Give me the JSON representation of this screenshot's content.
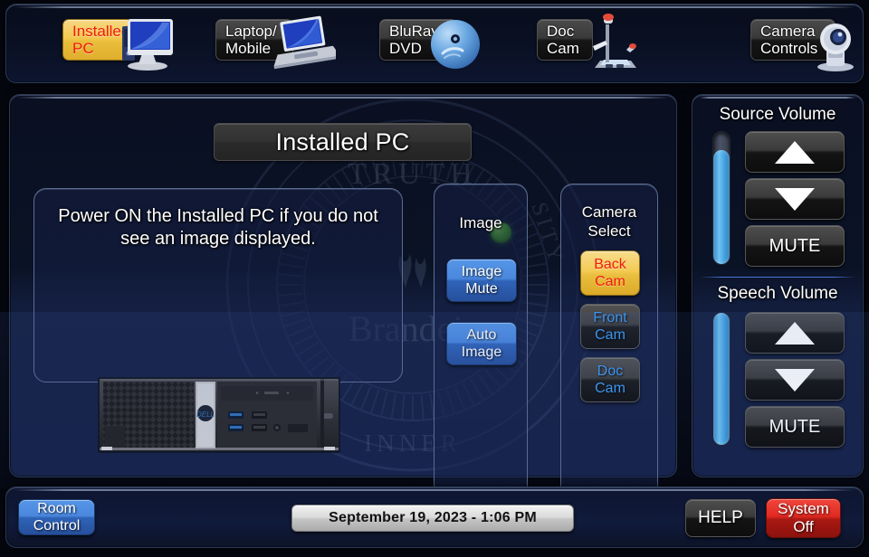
{
  "colors": {
    "active_source_bg": "#f2c94f",
    "active_source_text": "#f21a0c",
    "blue_button": "#4a87dd",
    "status_lamp": "#49b025",
    "system_off": "#e02a22",
    "slider_fill": "#49a6e4"
  },
  "topbar": {
    "sources": [
      {
        "label": "Installed\nPC",
        "icon": "desktop-pc-icon",
        "active": true
      },
      {
        "label": "Laptop/\nMobile",
        "icon": "laptop-icon",
        "active": false
      },
      {
        "label": "BluRay/\nDVD",
        "icon": "optical-disc-icon",
        "active": false
      },
      {
        "label": "Doc\nCam",
        "icon": "document-camera-icon",
        "active": false
      },
      {
        "label": "Camera\nControls",
        "icon": "ptz-camera-icon",
        "active": false
      }
    ]
  },
  "main": {
    "title": "Installed PC",
    "status_lamp_on": true,
    "info_text": "Power ON the Installed PC if you do not see an image displayed.",
    "device_image": "dell-desktop-pc",
    "watermark": "brandeis-university-seal",
    "image_panel": {
      "title": "Image",
      "buttons": [
        {
          "label": "Image\nMute"
        },
        {
          "label": "Auto\nImage"
        }
      ]
    },
    "camera_panel": {
      "title": "Camera\nSelect",
      "buttons": [
        {
          "label": "Back\nCam",
          "selected": true
        },
        {
          "label": "Front\nCam",
          "selected": false
        },
        {
          "label": "Doc\nCam",
          "selected": false
        }
      ]
    }
  },
  "volume": {
    "source": {
      "title": "Source Volume",
      "level_percent": 86,
      "up_label": "",
      "down_label": "",
      "mute_label": "MUTE"
    },
    "speech": {
      "title": "Speech Volume",
      "level_percent": 100,
      "up_label": "",
      "down_label": "",
      "mute_label": "MUTE"
    }
  },
  "bottombar": {
    "room_control_label": "Room\nControl",
    "clock": "September 19, 2023  -  1:06 PM",
    "help_label": "HELP",
    "system_off_label": "System\nOff"
  }
}
